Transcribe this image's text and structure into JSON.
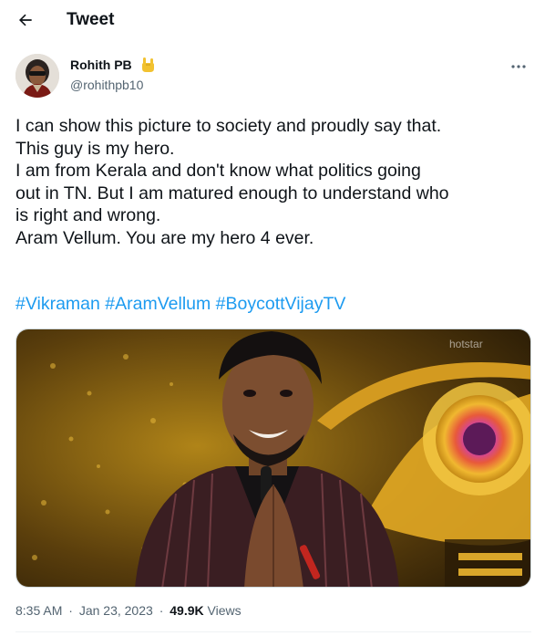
{
  "header": {
    "title": "Tweet"
  },
  "tweet": {
    "author": {
      "display_name": "Rohith PB",
      "name_emoji": "🤘",
      "handle": "@rohithpb10"
    },
    "text_lines": [
      "I can show this picture to society and proudly say that.",
      "This guy is my hero.",
      "I am from Kerala and don't know what politics going",
      "out in TN. But I am matured enough to understand who",
      "is right and wrong.",
      "Aram Vellum. You are my hero 4 ever."
    ],
    "hashtags": [
      "#Vikraman",
      "#AramVellum",
      "#BoycottVijayTV"
    ],
    "media": {
      "watermark": "hotstar"
    },
    "time": "8:35 AM",
    "date": "Jan 23, 2023",
    "views_count": "49.9K",
    "views_label": "Views"
  },
  "colors": {
    "link": "#1d9bf0",
    "text_primary": "#0f1419",
    "text_secondary": "#536471",
    "emoji": "#f2c230"
  },
  "icons": {
    "back": "arrow-left-icon",
    "more": "more-horizontal-icon"
  }
}
